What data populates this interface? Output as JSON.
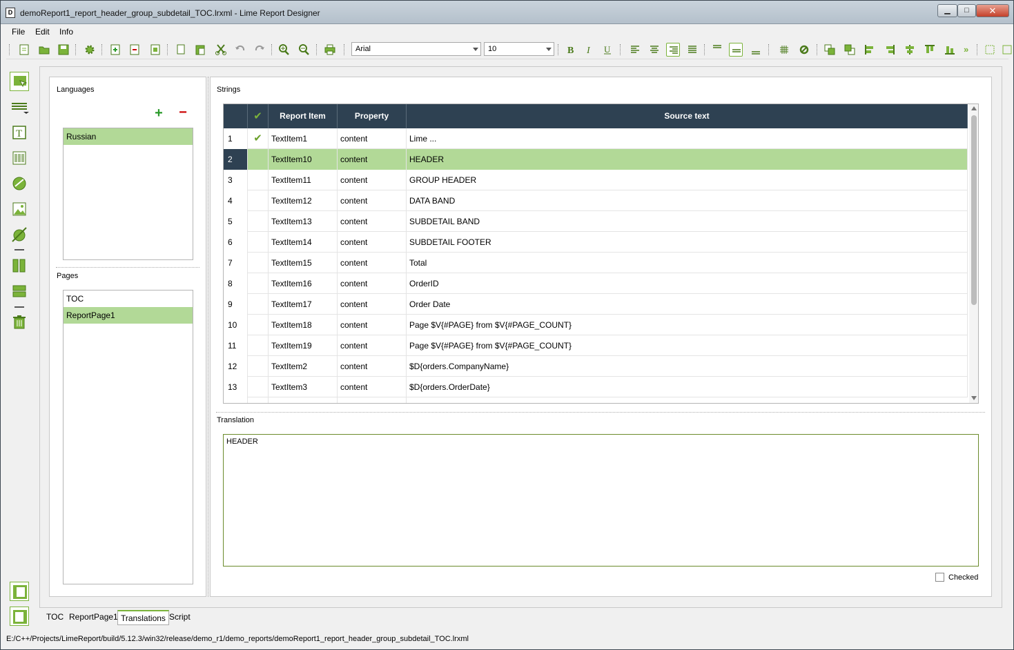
{
  "window": {
    "title": "demoReport1_report_header_group_subdetail_TOC.lrxml - Lime Report Designer",
    "controls": {
      "minimize": "▁",
      "maximize": "□",
      "close": "✕"
    }
  },
  "menu": [
    "File",
    "Edit",
    "Info"
  ],
  "toolbar": {
    "font": "Arial",
    "font_size": "10",
    "icons": [
      "new-report-icon",
      "open-icon",
      "save-icon",
      "settings-icon",
      "add-page-icon",
      "delete-page-icon",
      "page-settings-icon",
      "copy-icon",
      "paste-icon",
      "cut-icon",
      "undo-icon",
      "redo-icon",
      "zoom-in-icon",
      "zoom-out-icon",
      "print-icon",
      "bold-icon",
      "italic-icon",
      "underline-icon",
      "align-left-icon",
      "align-center-icon",
      "align-right-icon",
      "align-justify-icon",
      "valign-top-icon",
      "valign-center-icon",
      "valign-bottom-icon",
      "grid-icon",
      "link-icon",
      "bring-front-icon",
      "send-back-icon",
      "align-left-edges-icon",
      "align-right-edges-icon",
      "align-vcenter-icon",
      "align-top-edges-icon",
      "align-bottom-edges-icon"
    ]
  },
  "left_tools": [
    "select-tool-icon",
    "band-tool-icon",
    "text-item-icon",
    "barcode-icon",
    "shape-icon",
    "image-icon",
    "chart-icon",
    "horizontal-layout-icon",
    "vertical-layout-icon",
    "delete-icon"
  ],
  "languages": {
    "label": "Languages",
    "add": "+",
    "remove": "−",
    "items": [
      {
        "label": "Russian",
        "selected": true
      }
    ]
  },
  "pages": {
    "label": "Pages",
    "items": [
      {
        "label": "TOC",
        "selected": false
      },
      {
        "label": "ReportPage1",
        "selected": true
      }
    ]
  },
  "strings": {
    "label": "Strings",
    "columns": {
      "check": "✔",
      "item": "Report Item",
      "property": "Property",
      "source": "Source text"
    },
    "rows": [
      {
        "n": "1",
        "checked": "✔",
        "item": "TextItem1",
        "property": "content",
        "source": "Lime ..."
      },
      {
        "n": "2",
        "checked": "",
        "item": "TextItem10",
        "property": "content",
        "source": "HEADER"
      },
      {
        "n": "3",
        "checked": "",
        "item": "TextItem11",
        "property": "content",
        "source": "GROUP HEADER"
      },
      {
        "n": "4",
        "checked": "",
        "item": "TextItem12",
        "property": "content",
        "source": "DATA BAND"
      },
      {
        "n": "5",
        "checked": "",
        "item": "TextItem13",
        "property": "content",
        "source": "SUBDETAIL BAND"
      },
      {
        "n": "6",
        "checked": "",
        "item": "TextItem14",
        "property": "content",
        "source": "SUBDETAIL FOOTER"
      },
      {
        "n": "7",
        "checked": "",
        "item": "TextItem15",
        "property": "content",
        "source": "Total"
      },
      {
        "n": "8",
        "checked": "",
        "item": "TextItem16",
        "property": "content",
        "source": "OrderID"
      },
      {
        "n": "9",
        "checked": "",
        "item": "TextItem17",
        "property": "content",
        "source": "Order Date"
      },
      {
        "n": "10",
        "checked": "",
        "item": "TextItem18",
        "property": "content",
        "source": "Page $V{#PAGE} from $V{#PAGE_COUNT}"
      },
      {
        "n": "11",
        "checked": "",
        "item": "TextItem19",
        "property": "content",
        "source": "Page $V{#PAGE} from $V{#PAGE_COUNT}"
      },
      {
        "n": "12",
        "checked": "",
        "item": "TextItem2",
        "property": "content",
        "source": "$D{orders.CompanyName}"
      },
      {
        "n": "13",
        "checked": "",
        "item": "TextItem3",
        "property": "content",
        "source": "$D{orders.OrderDate}"
      }
    ],
    "selected_row": 2
  },
  "translation": {
    "label": "Translation",
    "value": "HEADER",
    "checked_label": "Checked",
    "checked": false
  },
  "tabs": [
    {
      "label": "TOC",
      "active": false
    },
    {
      "label": "ReportPage1",
      "active": false
    },
    {
      "label": "Translations",
      "active": true
    },
    {
      "label": "Script",
      "active": false
    }
  ],
  "status": "E:/C++/Projects/LimeReport/build/5.12.3/win32/release/demo_r1/demo_reports/demoReport1_report_header_group_subdetail_TOC.lrxml",
  "colors": {
    "accent": "#7bb33a",
    "selection": "#b2d997",
    "header": "#2e4152"
  }
}
